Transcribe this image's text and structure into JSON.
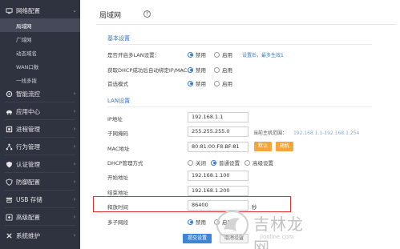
{
  "colors": {
    "sidebar_bg": "#2f3340",
    "accent": "#3778c6",
    "highlight": "#e0302b",
    "button_orange": "#f3a73a",
    "button_blue": "#3d86d6"
  },
  "sidebar": {
    "network": {
      "label": "网络配置",
      "icon": "network-icon"
    },
    "sub_items": [
      "局域网",
      "广域网",
      "动态域名",
      "WAN口数",
      "一线多拨"
    ],
    "items": [
      {
        "label": "智能流控",
        "icon": "flow-control-icon"
      },
      {
        "label": "应用中心",
        "icon": "app-center-icon"
      },
      {
        "label": "进程管理",
        "icon": "process-icon"
      },
      {
        "label": "行为管理",
        "icon": "behavior-icon"
      },
      {
        "label": "认证管理",
        "icon": "auth-shield-icon"
      },
      {
        "label": "防御配置",
        "icon": "defense-shield-icon"
      },
      {
        "label": "USB 存储",
        "icon": "usb-icon"
      },
      {
        "label": "高级配置",
        "icon": "advanced-icon"
      },
      {
        "label": "系统维护",
        "icon": "tools-icon"
      }
    ]
  },
  "main": {
    "title": "局域网",
    "help": "?",
    "basic_section": "基本设置",
    "lan_section": "LAN设置",
    "rows": {
      "isolation_label": "是否开启多LAN设置：",
      "dhcp_detect_label": "获取DHCP成功后自动绑定IP/MAC：",
      "preferred_label": "首选模式",
      "ip_label": "IP地址",
      "mask_label": "子网掩码",
      "mac_label": "MAC地址",
      "dhcp_mode_label": "DHCP管理方式",
      "start_label": "开始地址",
      "end_label": "结束地址",
      "lease_label": "释放时间",
      "multi_subnet_label": "多子网段"
    },
    "radios": {
      "disable": "禁用",
      "enable": "启用",
      "off": "关闭",
      "normal": "普通设置",
      "advanced": "高级设置"
    },
    "isolation_link": "设置后，最多生效1",
    "values": {
      "ip": "192.168.1.1",
      "mask": "255.255.255.0",
      "mac": "80:81:00:F8:BF:81",
      "start": "192.168.1.100",
      "end": "192.168.1.200",
      "lease": "86400"
    },
    "range_hint": "当前主机范围：",
    "range_value": "192.168.1.1-192.168.1.254",
    "lease_unit": "秒",
    "mac_btn_default": "默认",
    "mac_btn_random": "随机",
    "submit": "提交设置",
    "cancel": "取消设置"
  },
  "watermark": {
    "text": "吉林龙网",
    "url": "jlonline.com"
  }
}
